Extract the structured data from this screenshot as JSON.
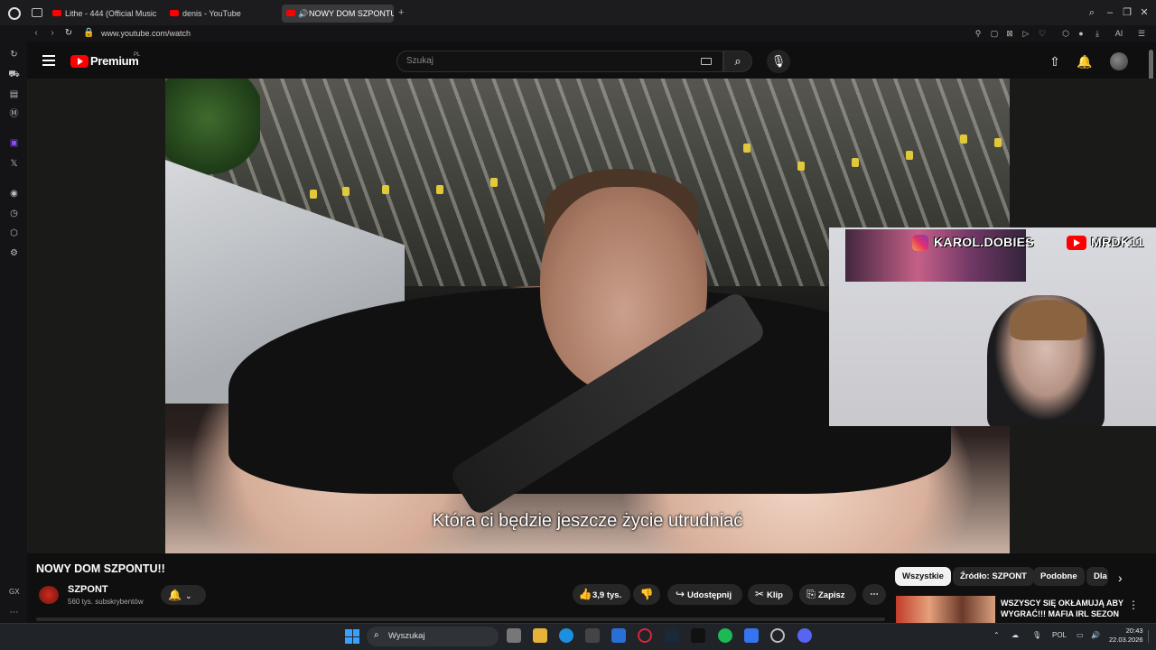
{
  "browser": {
    "tabs": [
      {
        "title": "Lithe - 444 (Official Music"
      },
      {
        "title": "denis - YouTube"
      },
      {
        "title": "NOWY DOM SZPONTU"
      }
    ],
    "url": "www.youtube.com/watch",
    "ai_label": "AI"
  },
  "youtube": {
    "brand": "Premium",
    "region": "PL",
    "search_placeholder": "Szukaj"
  },
  "video": {
    "subtitle": "Która ci będzie jeszcze życie utrudniać",
    "overlay_instagram": "KAROL.DOBIES",
    "overlay_youtube": "MRDK11",
    "title": "NOWY DOM SZPONTU!!",
    "channel": "SZPONT",
    "subscribers": "560 tys. subskrybentów",
    "likes": "3,9 tys.",
    "share_label": "Udostępnij",
    "clip_label": "Klip",
    "save_label": "Zapisz"
  },
  "chips": [
    "Wszystkie",
    "Źródło: SZPONT",
    "Podobne",
    "Dla"
  ],
  "recommendation": {
    "title": "WSZYSCY SIĘ OKŁAMUJĄ ABY WYGRAĆ!!! MAFIA IRL SEZON ..."
  },
  "sidebar_gx": "GX",
  "taskbar": {
    "search": "Wyszukaj",
    "lang": "POL",
    "time": "20:43",
    "date": "22.03.2026"
  },
  "colors": {
    "accent": "#ff0000",
    "background": "#0f0f0f",
    "taskbar": "#202327"
  }
}
